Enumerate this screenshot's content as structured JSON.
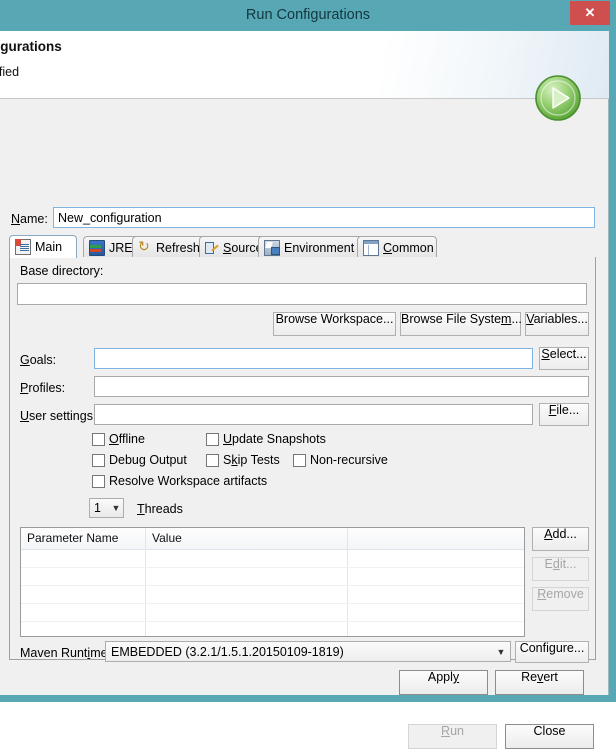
{
  "window": {
    "title": "Run Configurations",
    "close_icon": "close-x-icon"
  },
  "header": {
    "title": "configurations",
    "subtitle": "pecified",
    "logo_icon": "run-play-green-icon"
  },
  "name_row": {
    "label_pre": "N",
    "label_accel": "a",
    "label_post": "me:",
    "value": "New_configuration"
  },
  "tabs": [
    {
      "label": "Main",
      "icon": "main-config-icon",
      "active": true,
      "accel": ""
    },
    {
      "label": "JRE",
      "icon": "jre-icon",
      "active": false,
      "accel": ""
    },
    {
      "label": "Refresh",
      "icon": "refresh-icon",
      "active": false,
      "accel": ""
    },
    {
      "label": "Source",
      "icon": "source-icon",
      "active": false,
      "accel": "S"
    },
    {
      "label": "Environment",
      "icon": "environment-icon",
      "active": false,
      "accel": ""
    },
    {
      "label": "Common",
      "icon": "common-icon",
      "active": false,
      "accel": "C"
    }
  ],
  "main_tab": {
    "base_directory": {
      "label": "Base directory:",
      "value": ""
    },
    "dir_buttons": [
      {
        "label": "Browse Workspace...",
        "accel": ""
      },
      {
        "label": "Browse File System...",
        "accel": "m"
      },
      {
        "label": "Variables...",
        "accel": "V"
      }
    ],
    "goals": {
      "label": "Goals:",
      "accel": "G",
      "value": "",
      "button": "Select...",
      "button_accel": "S"
    },
    "profiles": {
      "label": "Profiles:",
      "accel": "P",
      "value": ""
    },
    "user_settings": {
      "label": "User settings:",
      "accel": "U",
      "value": "",
      "button": "File...",
      "button_accel": "F"
    },
    "checkboxes": [
      {
        "label": "Offline",
        "accel": "O",
        "checked": false
      },
      {
        "label": "Update Snapshots",
        "accel": "U",
        "checked": false
      },
      {
        "label": "Debug Output",
        "accel": "g",
        "checked": false
      },
      {
        "label": "Skip Tests",
        "accel": "k",
        "checked": false
      },
      {
        "label": "Non-recursive",
        "accel": "",
        "checked": false
      },
      {
        "label": "Resolve Workspace artifacts",
        "accel": "",
        "checked": false
      }
    ],
    "threads": {
      "value": "1",
      "label": "Threads",
      "accel": "T"
    },
    "parameters": {
      "columns": [
        "Parameter Name",
        "Value",
        ""
      ],
      "rows": [],
      "empty_row_count": 5,
      "buttons": [
        {
          "label": "Add...",
          "accel": "A",
          "enabled": true
        },
        {
          "label": "Edit...",
          "accel": "d",
          "enabled": false
        },
        {
          "label": "Remove",
          "accel": "R",
          "enabled": false
        }
      ]
    },
    "maven_runtime": {
      "label": "Maven Runtime:",
      "accel": "i",
      "value": "EMBEDDED (3.2.1/1.5.1.20150109-1819)",
      "button": "Configure...",
      "button_accel": ""
    }
  },
  "footer": {
    "apply": {
      "label": "Apply",
      "accel": "y",
      "enabled": true
    },
    "revert": {
      "label": "Revert",
      "accel": "v",
      "enabled": true
    },
    "run": {
      "label": "Run",
      "accel": "R",
      "enabled": false
    },
    "close": {
      "label": "Close",
      "enabled": true
    }
  },
  "colors": {
    "titlebar": "#57a7b5",
    "close_button": "#cf4f4f",
    "dialog_bg": "#f0f0f0",
    "focus_border": "#7eb4e2",
    "run_green": "#6fbf4a"
  }
}
